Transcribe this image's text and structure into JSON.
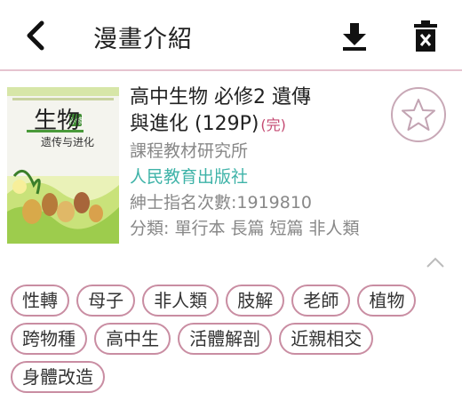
{
  "header": {
    "title": "漫畫介紹",
    "icons": [
      "back-icon",
      "download-icon",
      "trash-icon"
    ]
  },
  "cover": {
    "title_line1": "生物",
    "badge": "必修",
    "subtitle": "遗传与进化"
  },
  "manga": {
    "title_line1": "高中生物  必修2  遺傳",
    "title_line2": "與進化 (129P)",
    "status": "(完)",
    "author": "課程教材研究所",
    "publisher": "人民教育出版社",
    "views": "紳士指名次數:1919810",
    "categories": "分類:  單行本 長篇 短篇 非人類"
  },
  "tags": [
    "性轉",
    "母子",
    "非人類",
    "肢解",
    "老師",
    "植物",
    "跨物種",
    "高中生",
    "活體解剖",
    "近親相交",
    "身體改造"
  ],
  "colors": {
    "accent": "#c98da2",
    "header_border": "#e6c3cf",
    "publisher": "#3fb3a8",
    "status": "#c44a72"
  }
}
